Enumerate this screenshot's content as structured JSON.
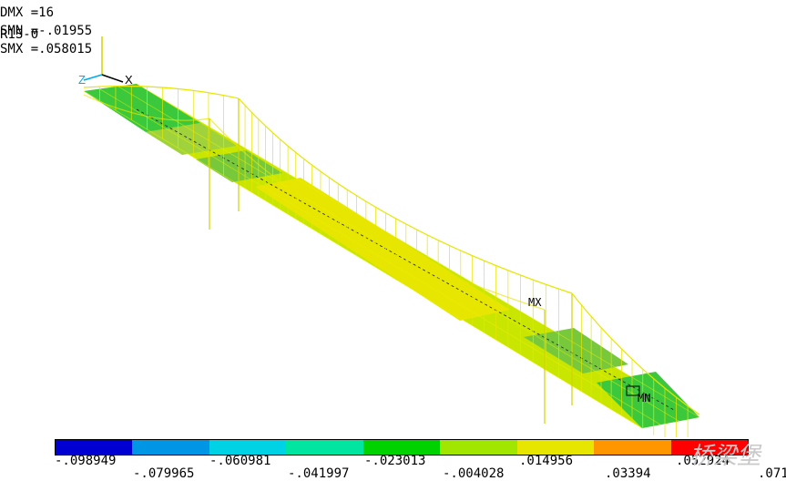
{
  "info": {
    "line0": "R1S-0",
    "dmx": "DMX =16",
    "smn": "SMN =-.01955",
    "smx": "SMX =.058015"
  },
  "triad": {
    "z_label": "Z",
    "x_label": "X"
  },
  "markers": {
    "mx": "MX",
    "mn": "MN"
  },
  "legend": {
    "colors": [
      "#0000d2",
      "#0096e6",
      "#00d2e6",
      "#00e6a0",
      "#00d200",
      "#a0e600",
      "#e6e600",
      "#ff9600",
      "#ff0000"
    ],
    "top_labels": [
      "-.098949",
      "-.060981",
      "-.023013",
      ".014956",
      ".052924"
    ],
    "bottom_labels": [
      "-.079965",
      "-.041997",
      "-.004028",
      ".03394",
      ".071"
    ]
  },
  "watermark": "桥梁堡"
}
